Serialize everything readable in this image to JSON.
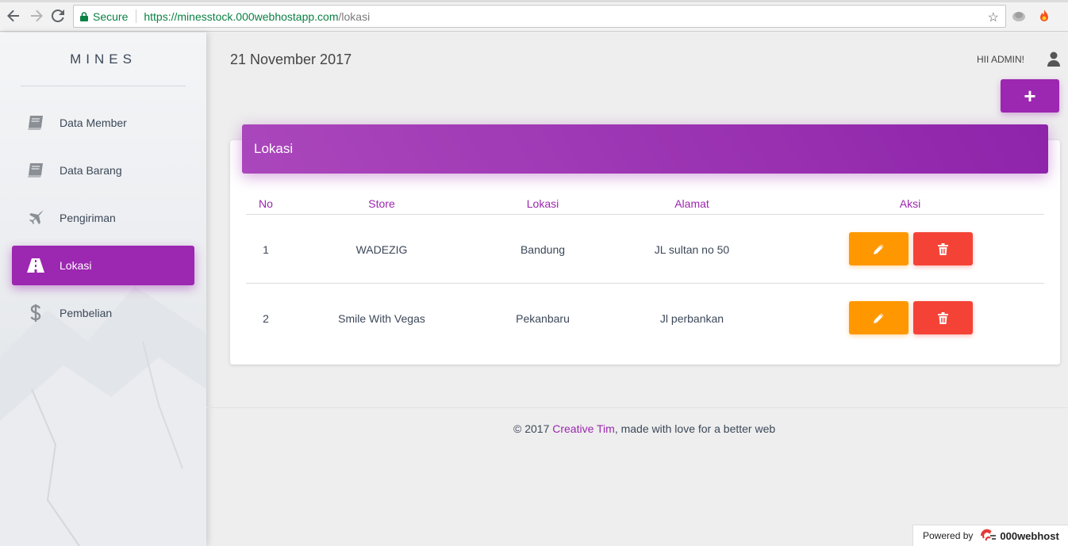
{
  "browser": {
    "secure_label": "Secure",
    "url_host": "https://minesstock.000webhostapp.com",
    "url_path": "/lokasi"
  },
  "sidebar": {
    "logo": "MINES",
    "items": [
      {
        "label": "Data Member",
        "icon": "book-icon",
        "active": false
      },
      {
        "label": "Data Barang",
        "icon": "book-icon",
        "active": false
      },
      {
        "label": "Pengiriman",
        "icon": "plane-icon",
        "active": false
      },
      {
        "label": "Lokasi",
        "icon": "road-icon",
        "active": true
      },
      {
        "label": "Pembelian",
        "icon": "dollar-icon",
        "active": false
      }
    ]
  },
  "header": {
    "date": "21 November 2017",
    "greeting": "HII ADMIN!",
    "add_button": "+"
  },
  "card": {
    "title": "Lokasi",
    "columns": [
      "No",
      "Store",
      "Lokasi",
      "Alamat",
      "Aksi"
    ],
    "rows": [
      {
        "no": "1",
        "store": "WADEZIG",
        "lokasi": "Bandung",
        "alamat": "JL sultan no 50"
      },
      {
        "no": "2",
        "store": "Smile With Vegas",
        "lokasi": "Pekanbaru",
        "alamat": "Jl perbankan"
      }
    ]
  },
  "footer": {
    "prefix": "© 2017 ",
    "link": "Creative Tim",
    "suffix": ", made with love for a better web"
  },
  "powered": {
    "label": "Powered by",
    "brand": "000webhost"
  },
  "colors": {
    "primary": "#9c27b0",
    "warning": "#ff9800",
    "danger": "#f44336"
  }
}
